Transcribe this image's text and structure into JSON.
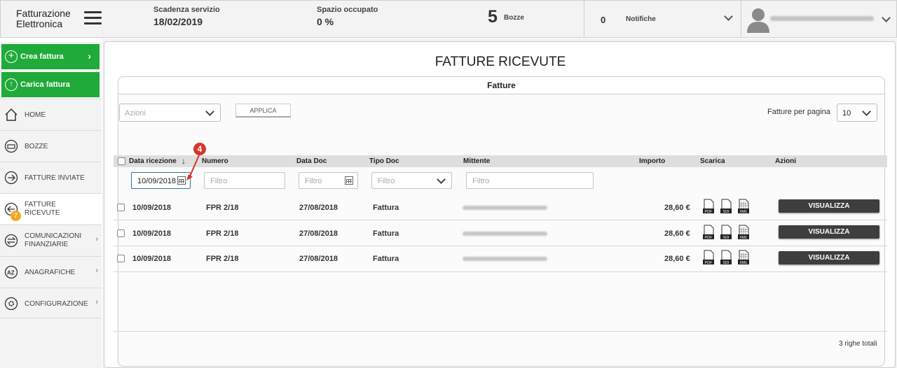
{
  "header": {
    "logo_line1": "Fatturazione",
    "logo_line2": "Elettronica",
    "scadenza_label": "Scadenza servizio",
    "scadenza_value": "18/02/2019",
    "spazio_label": "Spazio occupato",
    "spazio_value": "0 %",
    "bozze_count": "5",
    "bozze_label": "Bozze",
    "notifiche_count": "0",
    "notifiche_label": "Notifiche"
  },
  "sidebar": {
    "crea_fattura": "Crea fattura",
    "carica_fattura": "Carica fattura",
    "items": [
      {
        "label": "HOME"
      },
      {
        "label": "BOZZE"
      },
      {
        "label": "FATTURE INVIATE"
      },
      {
        "label_line1": "FATTURE",
        "label_line2": "RICEVUTE",
        "badge": "7"
      },
      {
        "label_line1": "COMUNICAZIONI",
        "label_line2": "FINANZIARIE"
      },
      {
        "label": "ANAGRAFICHE"
      },
      {
        "label": "CONFIGURAZIONE"
      }
    ]
  },
  "main": {
    "page_title": "FATTURE RICEVUTE",
    "tab_label": "Fatture",
    "azioni_placeholder": "Azioni",
    "applica_label": "APPLICA",
    "per_page_label": "Fatture per pagina",
    "per_page_value": "10",
    "columns": [
      "Data ricezione",
      "Numero",
      "Data Doc",
      "Tipo Doc",
      "Mittente",
      "Importo",
      "Scarica",
      "Azioni"
    ],
    "sort_indicator": "↓",
    "filters": {
      "data_ricezione_value": "10/09/2018",
      "numero_placeholder": "Filtro",
      "data_doc_placeholder": "Filtro",
      "tipo_doc_placeholder": "Filtro",
      "mittente_placeholder": "Filtro"
    },
    "rows": [
      {
        "data_ricezione": "10/09/2018",
        "numero": "FPR 2/18",
        "data_doc": "27/08/2018",
        "tipo_doc": "Fattura",
        "importo": "28,60 €"
      },
      {
        "data_ricezione": "10/09/2018",
        "numero": "FPR 2/18",
        "data_doc": "27/08/2018",
        "tipo_doc": "Fattura",
        "importo": "28,60 €"
      },
      {
        "data_ricezione": "10/09/2018",
        "numero": "FPR 2/18",
        "data_doc": "27/08/2018",
        "tipo_doc": "Fattura",
        "importo": "28,60 €"
      }
    ],
    "download_icons": [
      "PDF",
      "SDI",
      "XML"
    ],
    "visualizza_label": "VISUALIZZA",
    "total_label": "3 righe totali"
  },
  "annotation": {
    "step": "4"
  },
  "colors": {
    "accent_green": "#1faa3a",
    "badge_orange": "#f5a623",
    "annotation_red": "#d9342b",
    "button_dark": "#3e3e3e"
  }
}
